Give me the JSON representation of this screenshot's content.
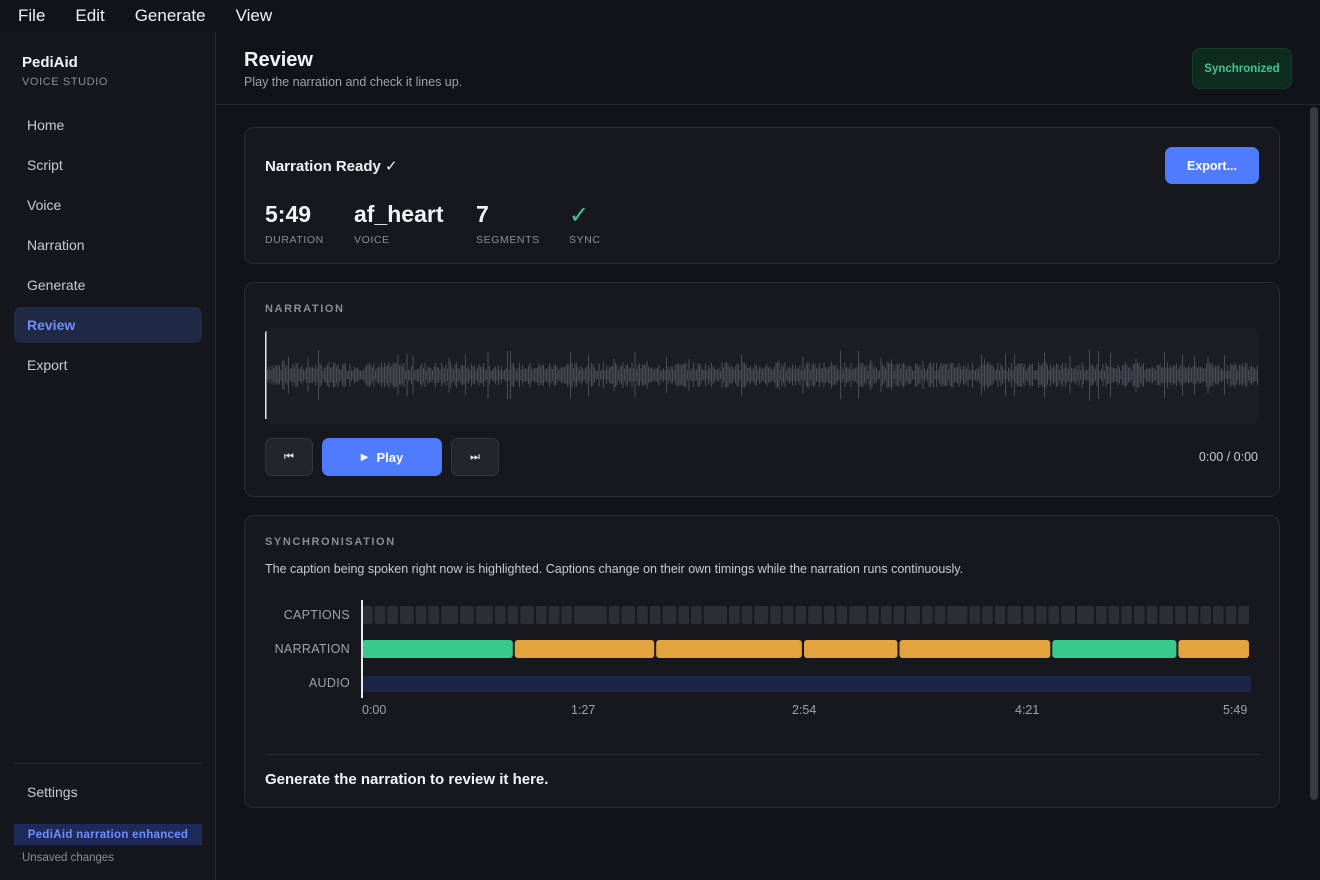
{
  "menu": [
    "File",
    "Edit",
    "Generate",
    "View"
  ],
  "brand": {
    "name": "PediAid",
    "subtitle": "VOICE STUDIO"
  },
  "nav": [
    {
      "label": "Home",
      "active": false
    },
    {
      "label": "Script",
      "active": false
    },
    {
      "label": "Voice",
      "active": false
    },
    {
      "label": "Narration",
      "active": false
    },
    {
      "label": "Generate",
      "active": false
    },
    {
      "label": "Review",
      "active": true
    },
    {
      "label": "Export",
      "active": false
    }
  ],
  "sidebar": {
    "settings_label": "Settings",
    "badge": "PediAid narration enhanced",
    "status": "Unsaved changes"
  },
  "header": {
    "title": "Review",
    "subtitle": "Play the narration and check it lines up.",
    "sync_status": "Synchronized"
  },
  "summary": {
    "title": "Narration Ready ✓",
    "export_label": "Export...",
    "stats": [
      {
        "value": "5:49",
        "label": "DURATION"
      },
      {
        "value": "af_heart",
        "label": "VOICE"
      },
      {
        "value": "7",
        "label": "SEGMENTS"
      },
      {
        "value": "✓",
        "label": "SYNC"
      }
    ]
  },
  "narration_panel": {
    "section_label": "NARRATION",
    "play_label": "Play",
    "prev_icon": "⏮",
    "next_icon": "⏭",
    "time": "0:00 / 0:00",
    "progress": 0
  },
  "sync_panel": {
    "section_label": "SYNCHRONISATION",
    "description": "The caption being spoken right now is highlighted. Captions change on their own timings while the narration runs continuously.",
    "tracks": [
      "CAPTIONS",
      "NARRATION",
      "AUDIO"
    ],
    "ticks": [
      "0:00",
      "1:27",
      "2:54",
      "4:21",
      "5:49"
    ],
    "total_seconds": 349,
    "narration_segments": [
      {
        "start": 0,
        "end": 60,
        "status": "ok"
      },
      {
        "start": 60,
        "end": 115.5,
        "status": "warn"
      },
      {
        "start": 115.5,
        "end": 173.5,
        "status": "warn"
      },
      {
        "start": 173.5,
        "end": 211,
        "status": "warn"
      },
      {
        "start": 211,
        "end": 271,
        "status": "warn"
      },
      {
        "start": 271,
        "end": 320.5,
        "status": "ok"
      },
      {
        "start": 320.5,
        "end": 349,
        "status": "warn"
      }
    ],
    "caption_durations": [
      4,
      4,
      4,
      5,
      4,
      4,
      6,
      5,
      6,
      4,
      4,
      5,
      4,
      4,
      4,
      11,
      4,
      5,
      4,
      4,
      5,
      4,
      4,
      8,
      4,
      4,
      5,
      4,
      4,
      4,
      5,
      4,
      4,
      6,
      4,
      4,
      4,
      5,
      4,
      4,
      7,
      4,
      4,
      4,
      5,
      4,
      4,
      4,
      5,
      6,
      4,
      4,
      4,
      4,
      4,
      5,
      4,
      4,
      4,
      4,
      4,
      4
    ],
    "colors": {
      "ok": "#37c98d",
      "warn": "#e3a33e",
      "caption": "#2c2d35",
      "audio": "#1c2547"
    },
    "message": "Generate the narration to review it here."
  }
}
